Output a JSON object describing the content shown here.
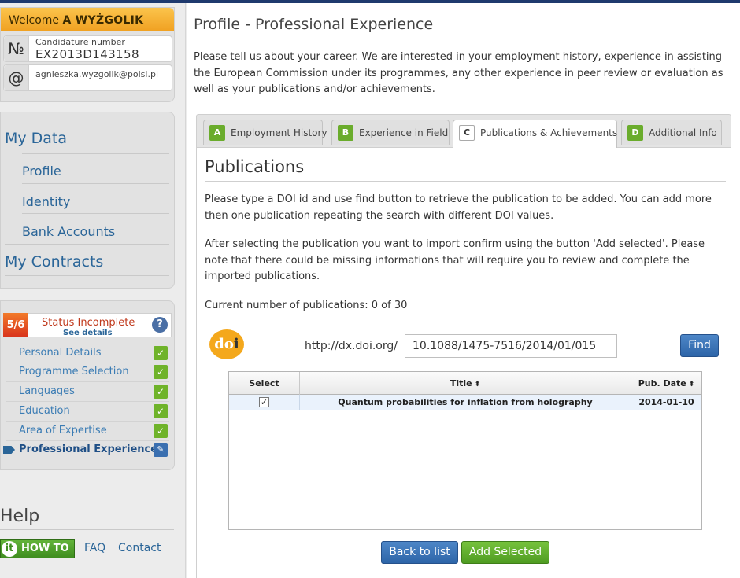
{
  "welcome": {
    "prefix": "Welcome",
    "name": "A WYŻGOLIK"
  },
  "candidature": {
    "label": "Candidature number",
    "value": "EX2013D143158",
    "icon": "user-id-icon",
    "icon_text": "№"
  },
  "email": {
    "value": "agnieszka.wyzgolik@polsl.pl",
    "icon": "at-icon",
    "icon_text": "@"
  },
  "nav": {
    "my_data": "My Data",
    "items": [
      "Profile",
      "Identity",
      "Bank Accounts"
    ],
    "my_contracts": "My Contracts"
  },
  "status": {
    "step": "5/6",
    "text": "Status Incomplete",
    "details": "See details",
    "help": "?",
    "steps": [
      {
        "label": "Personal Details",
        "state": "✓"
      },
      {
        "label": "Programme Selection",
        "state": "✓"
      },
      {
        "label": "Languages",
        "state": "✓"
      },
      {
        "label": "Education",
        "state": "✓"
      },
      {
        "label": "Area of Expertise",
        "state": "✓"
      },
      {
        "label": "Professional Experience",
        "state": "✎"
      }
    ]
  },
  "help": {
    "title": "Help",
    "howto": "HOW TO",
    "howto_icon": "it",
    "faq": "FAQ",
    "contact": "Contact"
  },
  "page": {
    "title": "Profile - Professional Experience",
    "intro": "Please tell us about your career. We are interested in your employment history, experience in assisting the European Commission under its programmes, any other experience in peer review or evaluation as well as your publications and/or achievements."
  },
  "tabs": [
    {
      "letter": "A",
      "label": "Employment History"
    },
    {
      "letter": "B",
      "label": "Experience in Field"
    },
    {
      "letter": "C",
      "label": "Publications & Achievements"
    },
    {
      "letter": "D",
      "label": "Additional Info"
    }
  ],
  "publications": {
    "title": "Publications",
    "para1": "Please type a DOI id and use find button to retrieve the publication to be added. You can add more then one publication repeating the search with different DOI values.",
    "para2": "After selecting the publication you want to import confirm using the button 'Add selected'. Please note that there could be missing informations that will require you to review and complete the imported publications.",
    "count": "Current number of publications: 0 of 30",
    "doi_logo_d": "d",
    "doi_logo_o": "o",
    "doi_logo_i": "i",
    "doi_prefix": "http://dx.doi.org/",
    "doi_value": "10.1088/1475-7516/2014/01/015",
    "find_label": "Find",
    "grid": {
      "headers": {
        "select": "Select",
        "title": "Title",
        "date": "Pub. Date"
      },
      "sort_glyph": "⬍",
      "rows": [
        {
          "checked": "✓",
          "title": "Quantum probabilities for inflation from holography",
          "date": "2014-01-10"
        }
      ]
    },
    "back_label": "Back to list",
    "add_label": "Add Selected"
  }
}
